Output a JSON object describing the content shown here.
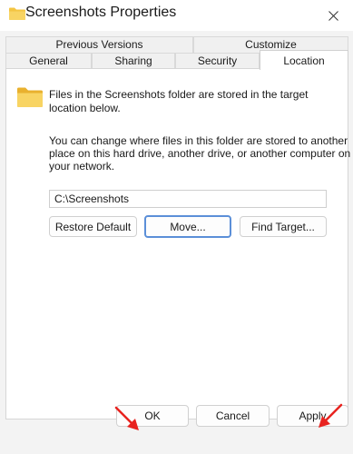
{
  "window": {
    "title": "Screenshots Properties"
  },
  "tabs": {
    "row1": [
      {
        "label": "Previous Versions"
      },
      {
        "label": "Customize"
      }
    ],
    "row2": [
      {
        "label": "General"
      },
      {
        "label": "Sharing"
      },
      {
        "label": "Security"
      },
      {
        "label": "Location",
        "active": true
      }
    ]
  },
  "location": {
    "info_line1": "Files in the Screenshots folder are stored in the target",
    "info_line2": "location below.",
    "desc_line1": "You can change where files in this folder are stored to another",
    "desc_line2": "place on this hard drive, another drive, or another computer on",
    "desc_line3": "your network.",
    "path_value": "C:\\Screenshots",
    "restore_label": "Restore Default",
    "move_label": "Move...",
    "find_label": "Find Target..."
  },
  "footer": {
    "ok_label": "OK",
    "cancel_label": "Cancel",
    "apply_label": "Apply"
  },
  "colors": {
    "folder": "#f4c542",
    "arrow": "#e8231f",
    "focus": "#5b8fd8"
  }
}
